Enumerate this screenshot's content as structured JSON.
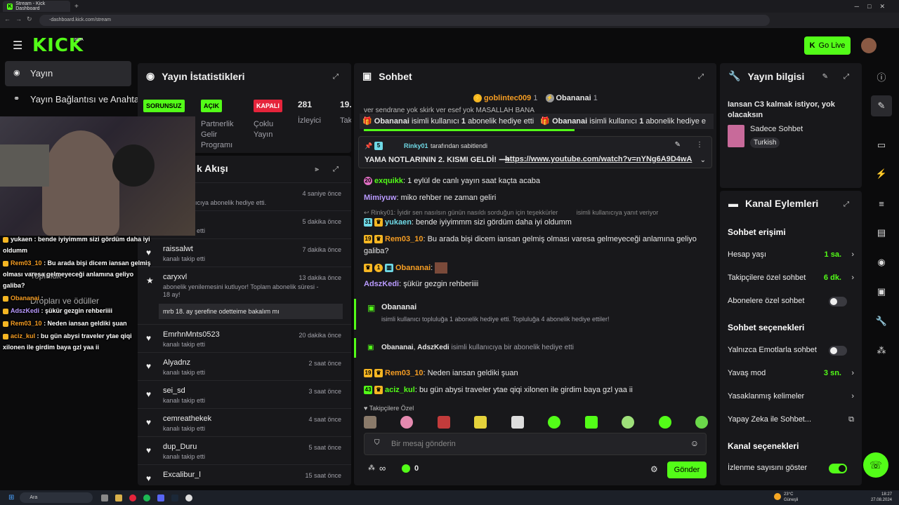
{
  "browser": {
    "tab_title": "Stream - Kick Dashboard",
    "url": "-dashboard.kick.com/stream"
  },
  "header": {
    "logo": "KICK",
    "logo_beta": "BETA",
    "go_live": "Go Live"
  },
  "sidebar": {
    "items": [
      {
        "label": "Yayın"
      },
      {
        "label": "Yayın Bağlantısı ve Anahtar"
      },
      {
        "label": "Topluluk"
      },
      {
        "label": "Dropları ve ödüller"
      }
    ]
  },
  "stats": {
    "title": "Yayın İstatistikleri",
    "badges": [
      "SORUNSUZ",
      "AÇIK",
      "KAPALI"
    ],
    "partner_label": "Partnerlik Gelir Programı",
    "multi_label": "Çoklu Yayın",
    "viewers": "281",
    "viewers_label": "İzleyici",
    "cut_value": "19.",
    "cut_label": "Tak"
  },
  "feed": {
    "title": "k Akışı",
    "items": [
      {
        "name": "",
        "sub": "isimli kullanıcıya abonelik hediye etti.",
        "time": "4 saniye önce"
      },
      {
        "name": "",
        "sub": "kanalı takip etti",
        "time": "5 dakika önce"
      },
      {
        "name": "raissalwt",
        "sub": "kanalı takip etti",
        "time": "7 dakika önce"
      },
      {
        "name": "caryxvl",
        "sub": "abonelik yenilemesini kutluyor! Toplam abonelik süresi - 18 ay!",
        "time": "13 dakika önce",
        "msg": "mrb 18. ay şerefine odetteime bakalım mı"
      },
      {
        "name": "EmrhnMnts0523",
        "sub": "kanalı takip etti",
        "time": "20 dakika önce"
      },
      {
        "name": "Alyadnz",
        "sub": "kanalı takip etti",
        "time": "2 saat önce"
      },
      {
        "name": "sei_sd",
        "sub": "kanalı takip etti",
        "time": "3 saat önce"
      },
      {
        "name": "cemreathekek",
        "sub": "kanalı takip etti",
        "time": "4 saat önce"
      },
      {
        "name": "dup_Duru",
        "sub": "kanalı takip etti",
        "time": "5 saat önce"
      },
      {
        "name": "Excalibur_l",
        "sub": "",
        "time": "15 saat önce"
      }
    ]
  },
  "chat": {
    "title": "Sohbet",
    "top_gifters": [
      {
        "name": "goblintec009",
        "count": "1"
      },
      {
        "name": "Obananai",
        "count": "1"
      }
    ],
    "partial_line": "ver sendrane yok skirk ver esef yok MASALLAH BANA",
    "gift_banner_1": {
      "name": "Obananai",
      "text": "isimli kullanıcı",
      "count": "1",
      "text2": "abonelik hediye etti"
    },
    "gift_banner_2": {
      "name": "Obananai",
      "text": "isimli kullanıcı",
      "count": "1",
      "text2": "abonelik hediye e"
    },
    "pinned": {
      "by": "Rinky01",
      "by_text": "tarafından sabitlendi",
      "text": "YAMA NOTLARININ 2. KISMI GELDİ! ⟶",
      "link": "https://www.youtube.com/watch?v=nYNg6A9D4wA"
    },
    "messages": [
      {
        "badge": "20",
        "user": "exquikk",
        "text": "1 eylül de canlı yayın saat kaçta acaba"
      },
      {
        "badge": "",
        "user": "Mimiyuw",
        "text": "miko rehber ne zaman geliri"
      },
      {
        "reply": "Rinky01: İyidir sen nasılsın günün nasıldı sorduğun için teşekkürler",
        "reply2": "isimli kullanıcıya yanıt veriyor"
      },
      {
        "badge": "31",
        "user": "yukaen",
        "text": "bende iyiyimmm sizi gördüm daha iyi oldumm"
      },
      {
        "badge": "19",
        "user": "Rem03_10",
        "text": "Bu arada bişi dicem iansan gelmiş olması varesa gelmeyeceği anlamına geliyo",
        "text2": "galiba?"
      },
      {
        "badge": "1",
        "user": "Obananai",
        "text": ""
      },
      {
        "badge": "",
        "user": "AdszKedi",
        "text": "şükür gezgin rehberiiii"
      }
    ],
    "gift_card": {
      "name": "Obananai",
      "text": "isimli kullanıcı topluluğa 1 abonelik hediye etti. Topluluğa 4 abonelik hediye ettiler!"
    },
    "gift_line": {
      "name1": "Obananai",
      "name2": "AdszKedi",
      "text": "isimli kullanıcıya bir abonelik hediye etti"
    },
    "messages2": [
      {
        "badge": "19",
        "user": "Rem03_10",
        "text": "Neden iansan geldiki şuan"
      },
      {
        "badge": "43",
        "user": "aciz_kul",
        "text": "bu gün abysi traveler ytae qiqi xilonen ile girdim baya gzl yaa ii"
      }
    ],
    "emote_label": "Takipçilere Özel",
    "placeholder": "Bir mesaj gönderin",
    "infinity": "∞",
    "points": "0",
    "send": "Gönder"
  },
  "stream_info": {
    "title": "Yayın bilgisi",
    "stream_title": "Iansan C3 kalmak istiyor, yok olacaksın",
    "category": "Sadece Sohbet",
    "language": "Turkish"
  },
  "channel": {
    "title": "Kanal Eylemleri",
    "chat_access": "Sohbet erişimi",
    "account_age": "Hesap yaşı",
    "account_age_val": "1 sa.",
    "followers_only": "Takipçilere özel sohbet",
    "followers_only_val": "6 dk.",
    "subs_only": "Abonelere özel sohbet",
    "chat_options": "Sohbet seçenekleri",
    "emote_only": "Yalnızca Emotlarla sohbet",
    "slow_mode": "Yavaş mod",
    "slow_mode_val": "3 sn.",
    "banned_words": "Yasaklanmış kelimeler",
    "ai_chat": "Yapay Zeka ile Sohbet...",
    "channel_options": "Kanal seçenekleri",
    "show_viewers": "İzlenme sayısını göster"
  },
  "overlay_chat": [
    {
      "user": "yukaen",
      "text": ": bende iyiyimmm sizi gördüm daha iyi",
      "text2": "oldumm"
    },
    {
      "user": "Rem03_10",
      "text": ": Bu arada bişi dicem iansan gelmiş",
      "text2": "olması varesa gelmeyeceği anlamına geliyo",
      "text3": "galiba?"
    },
    {
      "user": "Obananai",
      "text": ":"
    },
    {
      "user": "AdszKedi",
      "text": ": şükür gezgin rehberiiii"
    },
    {
      "user": "Rem03_10",
      "text": ": Neden iansan geldiki şuan"
    },
    {
      "user": "aciz_kul",
      "text": ": bu gün abysi traveler ytae qiqi",
      "text2": "xilonen ile girdim baya gzl yaa ii"
    }
  ],
  "taskbar": {
    "search": "Ara",
    "weather_temp": "23°C",
    "weather": "Güneşli",
    "time": "18:27",
    "date": "27.08.2024"
  },
  "colors": {
    "accent": "#53fc18",
    "panel": "#18181b",
    "bg": "#0b0b0c"
  }
}
